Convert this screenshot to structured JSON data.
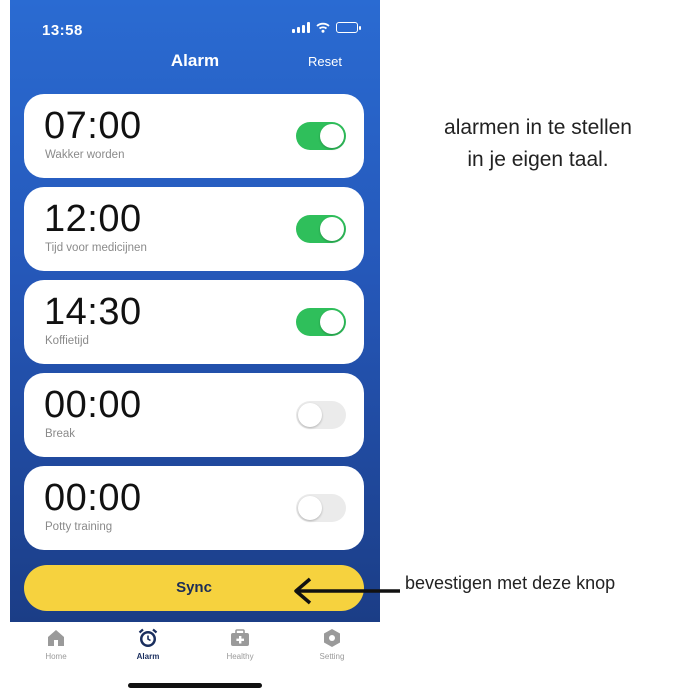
{
  "status_bar": {
    "time": "13:58"
  },
  "header": {
    "title": "Alarm",
    "reset_label": "Reset"
  },
  "alarms": [
    {
      "time": "07:00",
      "label": "Wakker worden",
      "enabled": true
    },
    {
      "time": "12:00",
      "label": "Tijd voor medicijnen",
      "enabled": true
    },
    {
      "time": "14:30",
      "label": "Koffietijd",
      "enabled": true
    },
    {
      "time": "00:00",
      "label": "Break",
      "enabled": false
    },
    {
      "time": "00:00",
      "label": "Potty training",
      "enabled": false
    }
  ],
  "sync": {
    "label": "Sync"
  },
  "tab_bar": {
    "tabs": [
      {
        "label": "Home",
        "icon": "home-icon",
        "active": false
      },
      {
        "label": "Alarm",
        "icon": "alarm-clock-icon",
        "active": true
      },
      {
        "label": "Healthy",
        "icon": "medical-kit-icon",
        "active": false
      },
      {
        "label": "Setting",
        "icon": "settings-hexagon-icon",
        "active": false
      }
    ]
  },
  "annotations": {
    "note_line1": "alarmen in te stellen",
    "note_line2": "in je eigen taal.",
    "sync_note": "bevestigen met deze knop"
  },
  "colors": {
    "gradient_top": "#2a6bd2",
    "gradient_bottom": "#1b3d86",
    "toggle_on": "#2fbf5b",
    "toggle_off": "#ebebeb",
    "sync_button": "#f6d23e",
    "active_tab": "#1a2e5e"
  }
}
